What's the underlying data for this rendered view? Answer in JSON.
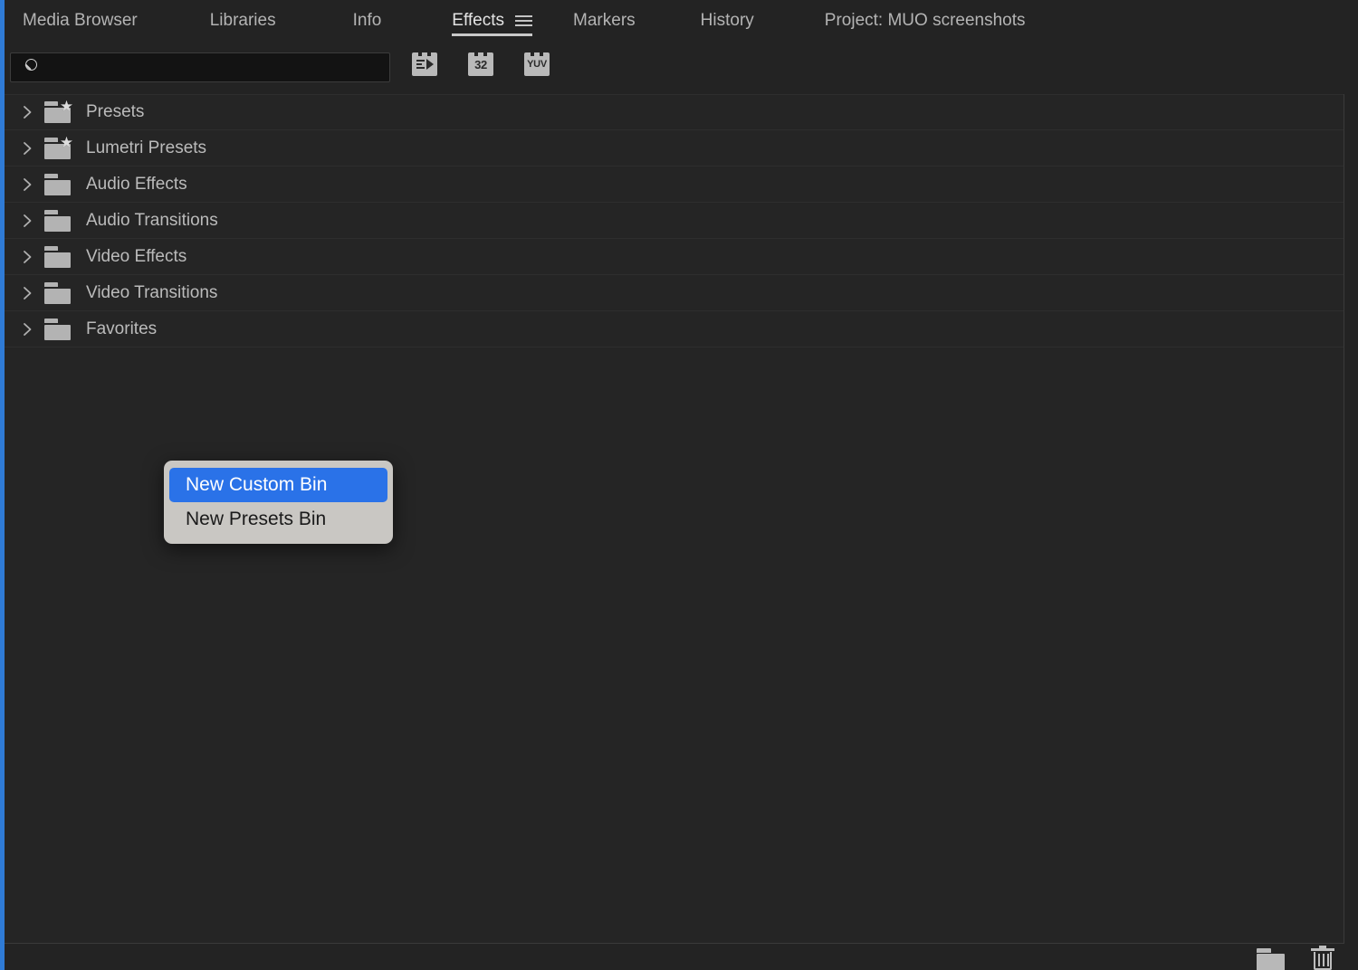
{
  "window": {
    "accent_color": "#2f7bd6",
    "panel_bg": "#232323",
    "row_bg": "#252525"
  },
  "tabbar": {
    "tabs": [
      {
        "label": "Media Browser",
        "active": false
      },
      {
        "label": "Libraries",
        "active": false
      },
      {
        "label": "Info",
        "active": false
      },
      {
        "label": "Effects",
        "active": true
      },
      {
        "label": "Markers",
        "active": false
      },
      {
        "label": "History",
        "active": false
      },
      {
        "label": "Project: MUO screenshots",
        "active": false
      }
    ],
    "panel_menu_icon": "hamburger-menu-icon"
  },
  "search": {
    "value": "",
    "placeholder": "",
    "icon": "search-icon"
  },
  "filters": [
    {
      "name": "accelerated-effects-filter",
      "label": "",
      "icon": "accelerated-effect-icon"
    },
    {
      "name": "32bit-color-filter",
      "label": "32",
      "icon": "32-bit-color-icon"
    },
    {
      "name": "yuv-color-filter",
      "label": "YUV",
      "icon": "yuv-color-icon"
    }
  ],
  "tree": {
    "items": [
      {
        "label": "Presets",
        "icon": "folder-star-icon",
        "starred": true,
        "expanded": false
      },
      {
        "label": "Lumetri Presets",
        "icon": "folder-star-icon",
        "starred": true,
        "expanded": false
      },
      {
        "label": "Audio Effects",
        "icon": "folder-icon",
        "starred": false,
        "expanded": false
      },
      {
        "label": "Audio Transitions",
        "icon": "folder-icon",
        "starred": false,
        "expanded": false
      },
      {
        "label": "Video Effects",
        "icon": "folder-icon",
        "starred": false,
        "expanded": false
      },
      {
        "label": "Video Transitions",
        "icon": "folder-icon",
        "starred": false,
        "expanded": false
      },
      {
        "label": "Favorites",
        "icon": "folder-icon",
        "starred": false,
        "expanded": false
      }
    ]
  },
  "context_menu": {
    "highlight_color": "#2a72e8",
    "background_color": "#c9c7c3",
    "items": [
      {
        "label": "New Custom Bin",
        "selected": true
      },
      {
        "label": "New Presets Bin",
        "selected": false
      }
    ]
  },
  "footer": {
    "new_custom_bin_icon": "new-bin-folder-icon",
    "delete_icon": "trash-icon"
  }
}
